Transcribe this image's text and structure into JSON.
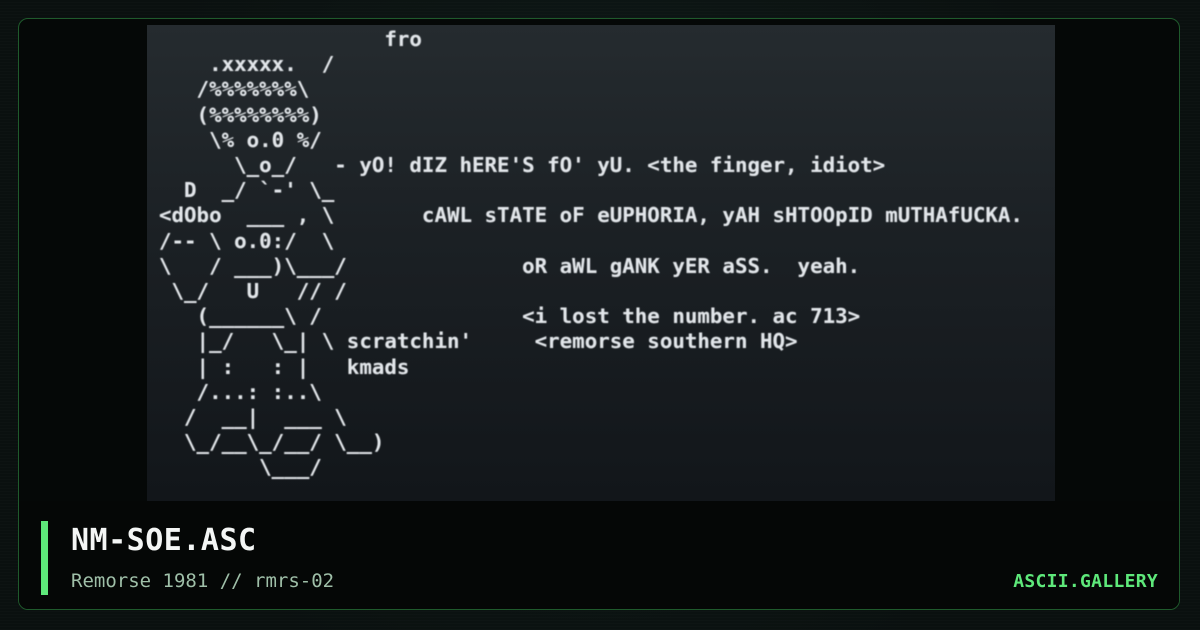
{
  "artwork": {
    "lines": [
      "                  fro",
      "    .xxxxx.  /",
      "   /%%%%%%%\\",
      "   (%%%%%%%%)",
      "    \\% o.0 %/",
      "      \\_o_/   - yO! dIZ hERE'S fO' yU. <the finger, idiot>",
      "  D  _/ `-' \\_",
      "<dObo  ___ , \\       cAWL sTATE oF eUPHORIA, yAH sHTOOpID mUTHAfUCKA.",
      "/-- \\ o.0:/  \\",
      "\\   / ___)\\___/              oR aWL gANK yER aSS.  yeah.",
      " \\_/   U   // /",
      "   (______\\ /                <i lost the number. ac 713>",
      "   |_/   \\_| \\ scratchin'     <remorse southern HQ>",
      "   | :   : |   kmads",
      "   /...: :..\\",
      "  /  __|  ___ \\",
      "  \\_/__\\_/__/ \\__)",
      "        \\___/"
    ]
  },
  "footer": {
    "title": "NM-SOE.ASC",
    "subtitle": "Remorse 1981 // rmrs-02",
    "brand": "ASCII.GALLERY"
  },
  "colors": {
    "accent": "#5ee87a",
    "border": "#1f5a2c",
    "screen_top": "#252b2f",
    "screen_bottom": "#12161a",
    "text": "#e2e6ea"
  }
}
